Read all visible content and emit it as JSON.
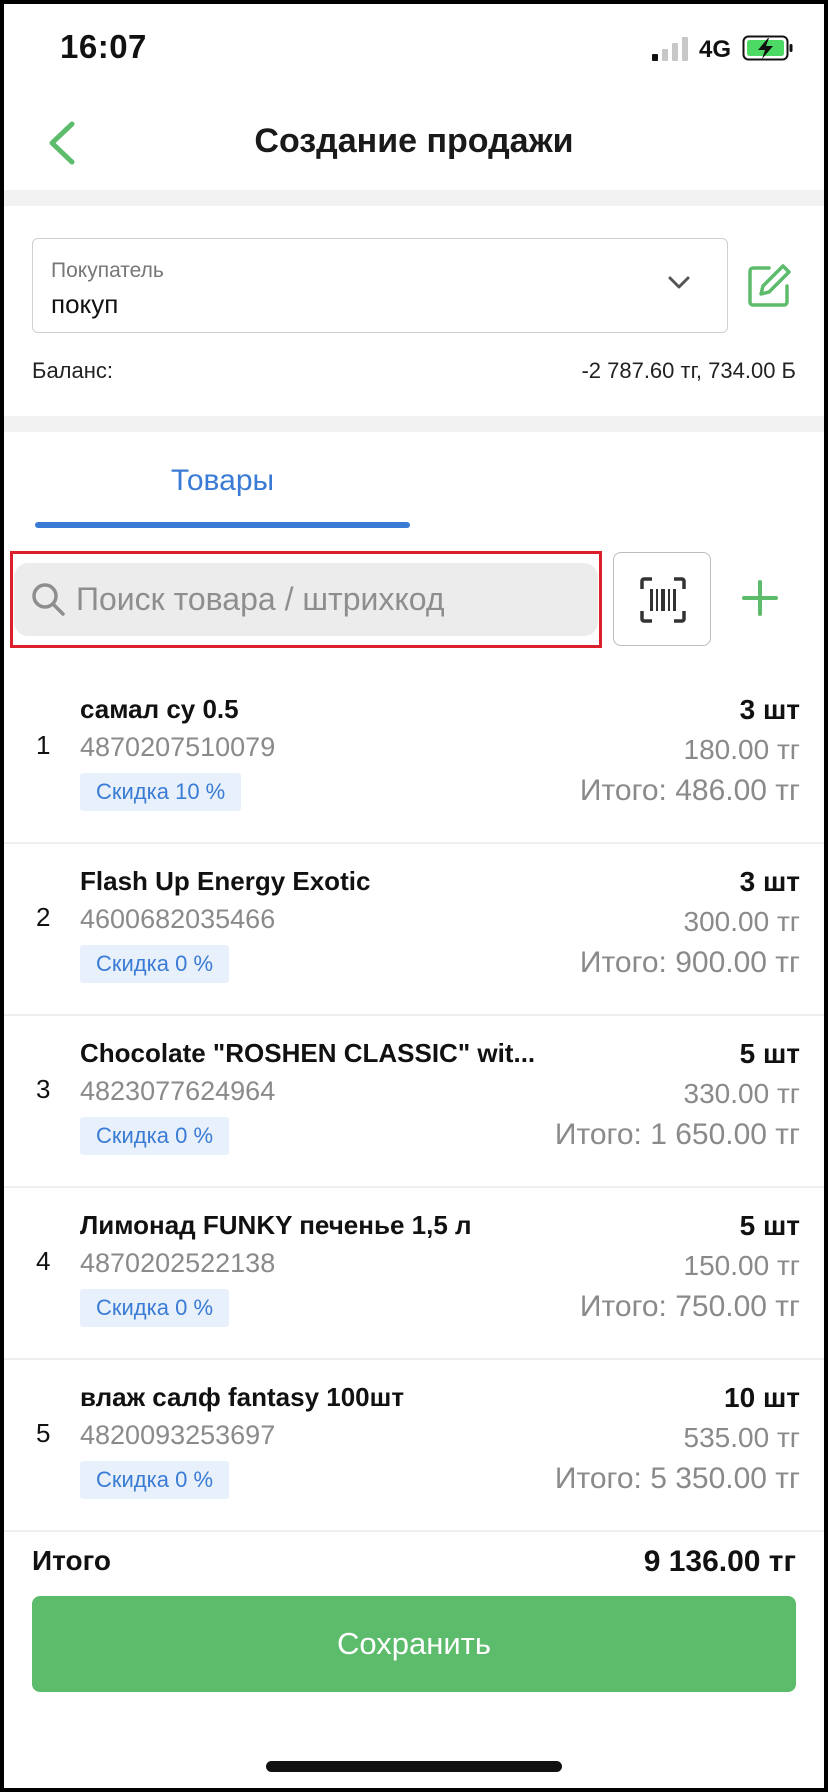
{
  "status_bar": {
    "time": "16:07",
    "network": "4G",
    "icons": [
      "signal-icon",
      "battery-charging-icon"
    ]
  },
  "header": {
    "title": "Создание продажи",
    "back_icon": "chevron-left-icon"
  },
  "customer": {
    "label": "Покупатель",
    "value": "покуп",
    "dropdown_icon": "chevron-down-icon",
    "edit_icon": "edit-icon"
  },
  "balance": {
    "label": "Баланс:",
    "value": "-2 787.60 тг, 734.00 Б"
  },
  "tabs": [
    {
      "label": "Товары",
      "active": true
    }
  ],
  "search": {
    "placeholder": "Поиск товара / штрихкод",
    "value": "",
    "scan_icon": "barcode-scan-icon",
    "add_icon": "plus-icon"
  },
  "items": [
    {
      "num": "1",
      "name": "самал су 0.5",
      "code": "4870207510079",
      "discount": "Скидка 10 %",
      "qty": "3 шт",
      "price": "180.00 тг",
      "total": "Итого: 486.00 тг"
    },
    {
      "num": "2",
      "name": "Flash Up Energy Exotic",
      "code": "4600682035466",
      "discount": "Скидка 0 %",
      "qty": "3 шт",
      "price": "300.00 тг",
      "total": "Итого: 900.00 тг"
    },
    {
      "num": "3",
      "name": "Chocolate \"ROSHEN CLASSIC\" wit...",
      "code": "4823077624964",
      "discount": "Скидка 0 %",
      "qty": "5 шт",
      "price": "330.00 тг",
      "total": "Итого: 1 650.00 тг"
    },
    {
      "num": "4",
      "name": "Лимонад FUNKY печенье 1,5 л",
      "code": "4870202522138",
      "discount": "Скидка 0 %",
      "qty": "5 шт",
      "price": "150.00 тг",
      "total": "Итого: 750.00 тг"
    },
    {
      "num": "5",
      "name": "влаж салф fantasy 100шт",
      "code": "4820093253697",
      "discount": "Скидка 0 %",
      "qty": "10 шт",
      "price": "535.00 тг",
      "total": "Итого: 5 350.00 тг"
    }
  ],
  "summary": {
    "label": "Итого",
    "value": "9 136.00 тг"
  },
  "save_button": {
    "label": "Сохранить"
  },
  "colors": {
    "accent_green": "#5cbc6c",
    "accent_blue": "#3a7bd5",
    "highlight_red": "#d9202b",
    "discount_bg": "#e7f0fb"
  }
}
